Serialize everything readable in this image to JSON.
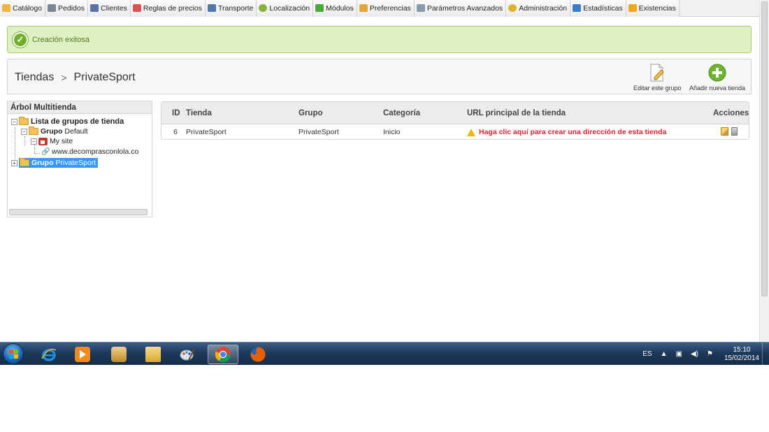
{
  "topnav": {
    "tabs": [
      {
        "label": "Catálogo",
        "icon": "folder-icon",
        "color": "#f0b43c"
      },
      {
        "label": "Pedidos",
        "icon": "orders-icon",
        "color": "#7a8794"
      },
      {
        "label": "Clientes",
        "icon": "customers-icon",
        "color": "#5a74a8"
      },
      {
        "label": "Reglas de precios",
        "icon": "price-rules-icon",
        "color": "#d9534f"
      },
      {
        "label": "Transporte",
        "icon": "truck-icon",
        "color": "#4f77a8"
      },
      {
        "label": "Localización",
        "icon": "globe-icon",
        "color": "#8ab13a"
      },
      {
        "label": "Módulos",
        "icon": "puzzle-icon",
        "color": "#4aa83a"
      },
      {
        "label": "Preferencias",
        "icon": "preferences-icon",
        "color": "#e1a93a"
      },
      {
        "label": "Parámetros Avanzados",
        "icon": "wrench-icon",
        "color": "#8a9aad"
      },
      {
        "label": "Administración",
        "icon": "key-icon",
        "color": "#e0b12c"
      },
      {
        "label": "Estadísticas",
        "icon": "stats-icon",
        "color": "#3a7cc9"
      },
      {
        "label": "Existencias",
        "icon": "stock-icon",
        "color": "#f0a820"
      }
    ]
  },
  "banner": {
    "message": "Creación exitosa"
  },
  "toolbar": {
    "breadcrumb": [
      "Tiendas",
      "PrivateSport"
    ],
    "separator": ">",
    "edit_group_label": "Editar este grupo",
    "add_store_label": "Añadir nueva tienda"
  },
  "tree": {
    "title": "Árbol Multitienda",
    "root_label": "Lista de grupos de tienda",
    "group1_prefix": "Grupo",
    "group1_name": "Default",
    "site_label": "My site",
    "url_label": "www.decomprasconlola.co",
    "group2_prefix": "Grupo",
    "group2_name": "PrivateSport"
  },
  "table": {
    "headers": {
      "id": "ID",
      "store": "Tienda",
      "group": "Grupo",
      "category": "Categoría",
      "url": "URL principal de la tienda",
      "actions": "Acciones"
    },
    "rows": [
      {
        "id": "6",
        "store": "PrivateSport",
        "group": "PrivateSport",
        "category": "Inicio",
        "url_warning": "Haga clic aquí para crear una dirección de esta tienda"
      }
    ]
  },
  "taskbar": {
    "language": "ES",
    "time": "15:10",
    "date": "15/02/2014",
    "apps": [
      {
        "icon": "internet-explorer-icon",
        "color": "#1a8fe0"
      },
      {
        "icon": "media-player-icon",
        "color": "#f08a1e"
      },
      {
        "icon": "app-icon",
        "color": "#d6a44a"
      },
      {
        "icon": "file-explorer-icon",
        "color": "#e8c15a"
      },
      {
        "icon": "paint-icon",
        "color": "#b8c6d8"
      },
      {
        "icon": "chrome-icon",
        "color": "#db4437"
      },
      {
        "icon": "firefox-icon",
        "color": "#e66000"
      }
    ]
  }
}
